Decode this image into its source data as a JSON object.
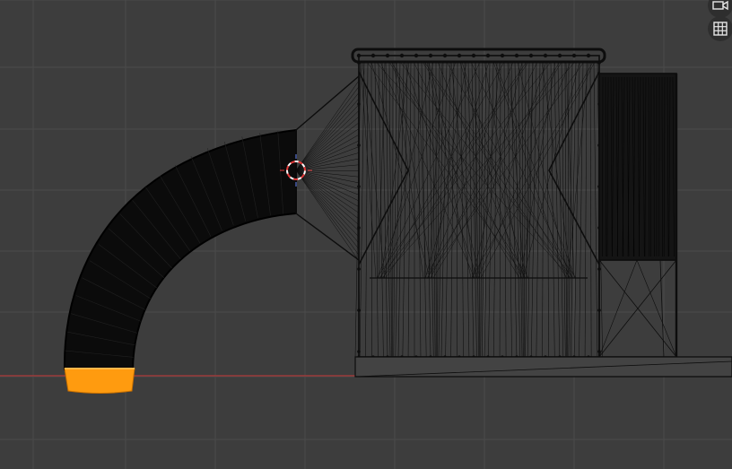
{
  "viewport": {
    "background": "#3d3d3d",
    "grid_color": "#4a4a4a",
    "x_axis_color": "#9b3a3a",
    "wire_color": "#0d0d0d",
    "selection_color": "#ff9b0f",
    "cursor_colors": [
      "#ffffff",
      "#e23a3a"
    ]
  },
  "nav_gizmo": {
    "buttons": [
      {
        "icon": "camera-icon"
      },
      {
        "icon": "grid-perspective-icon"
      }
    ]
  }
}
